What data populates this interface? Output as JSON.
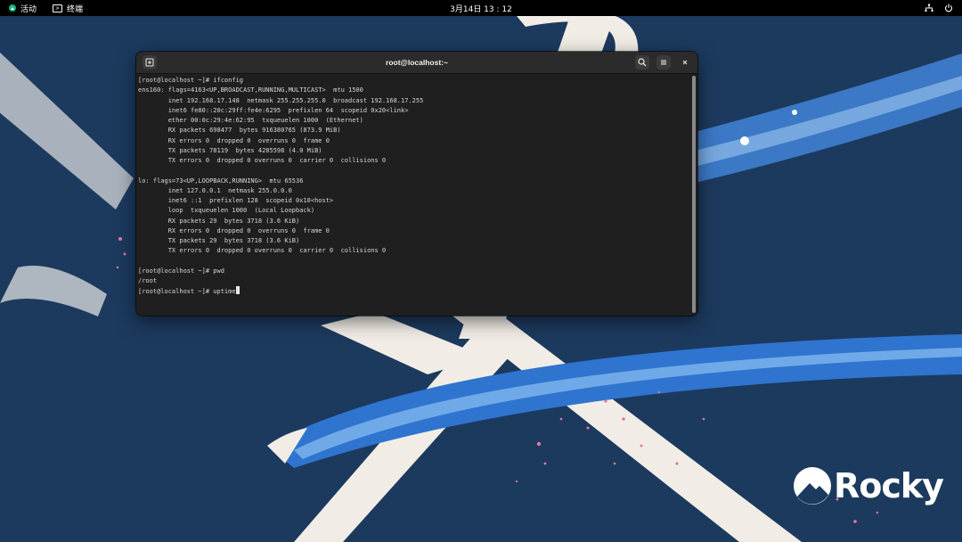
{
  "topbar": {
    "activities_label": "活动",
    "app_label": "终端",
    "clock": "3月14日  13 : 12"
  },
  "terminal": {
    "title": "root@localhost:~",
    "lines": [
      "[root@localhost ~]# ifconfig",
      "ens160: flags=4163<UP,BROADCAST,RUNNING,MULTICAST>  mtu 1500",
      "        inet 192.168.17.148  netmask 255.255.255.0  broadcast 192.168.17.255",
      "        inet6 fe80::20c:29ff:fe4e:6295  prefixlen 64  scopeid 0x20<link>",
      "        ether 00:0c:29:4e:62:95  txqueuelen 1000  (Ethernet)",
      "        RX packets 698477  bytes 916380765 (873.9 MiB)",
      "        RX errors 0  dropped 0  overruns 0  frame 0",
      "        TX packets 78119  bytes 4285598 (4.0 MiB)",
      "        TX errors 0  dropped 0 overruns 0  carrier 0  collisions 0",
      "",
      "lo: flags=73<UP,LOOPBACK,RUNNING>  mtu 65536",
      "        inet 127.0.0.1  netmask 255.0.0.0",
      "        inet6 ::1  prefixlen 128  scopeid 0x10<host>",
      "        loop  txqueuelen 1000  (Local Loopback)",
      "        RX packets 29  bytes 3718 (3.6 KiB)",
      "        RX errors 0  dropped 0  overruns 0  frame 0",
      "        TX packets 29  bytes 3718 (3.6 KiB)",
      "        TX errors 0  dropped 0 overruns 0  carrier 0  collisions 0",
      "",
      "[root@localhost ~]# pwd",
      "/root",
      "[root@localhost ~]# uptime"
    ]
  },
  "logo": {
    "text": "Rocky"
  },
  "colors": {
    "desktop_background": "#1c3a5e",
    "terminal_background": "#1f1f1f",
    "titlebar_background": "#2b2b2b",
    "logo_mark": "#ffffff"
  },
  "icons": {
    "activities": "rocky-icon",
    "app": "terminal-icon",
    "network": "network-icon",
    "power": "power-icon",
    "new_tab": "new-tab-icon",
    "search": "search-icon",
    "menu": "hamburger-menu-icon",
    "close": "close-icon"
  }
}
